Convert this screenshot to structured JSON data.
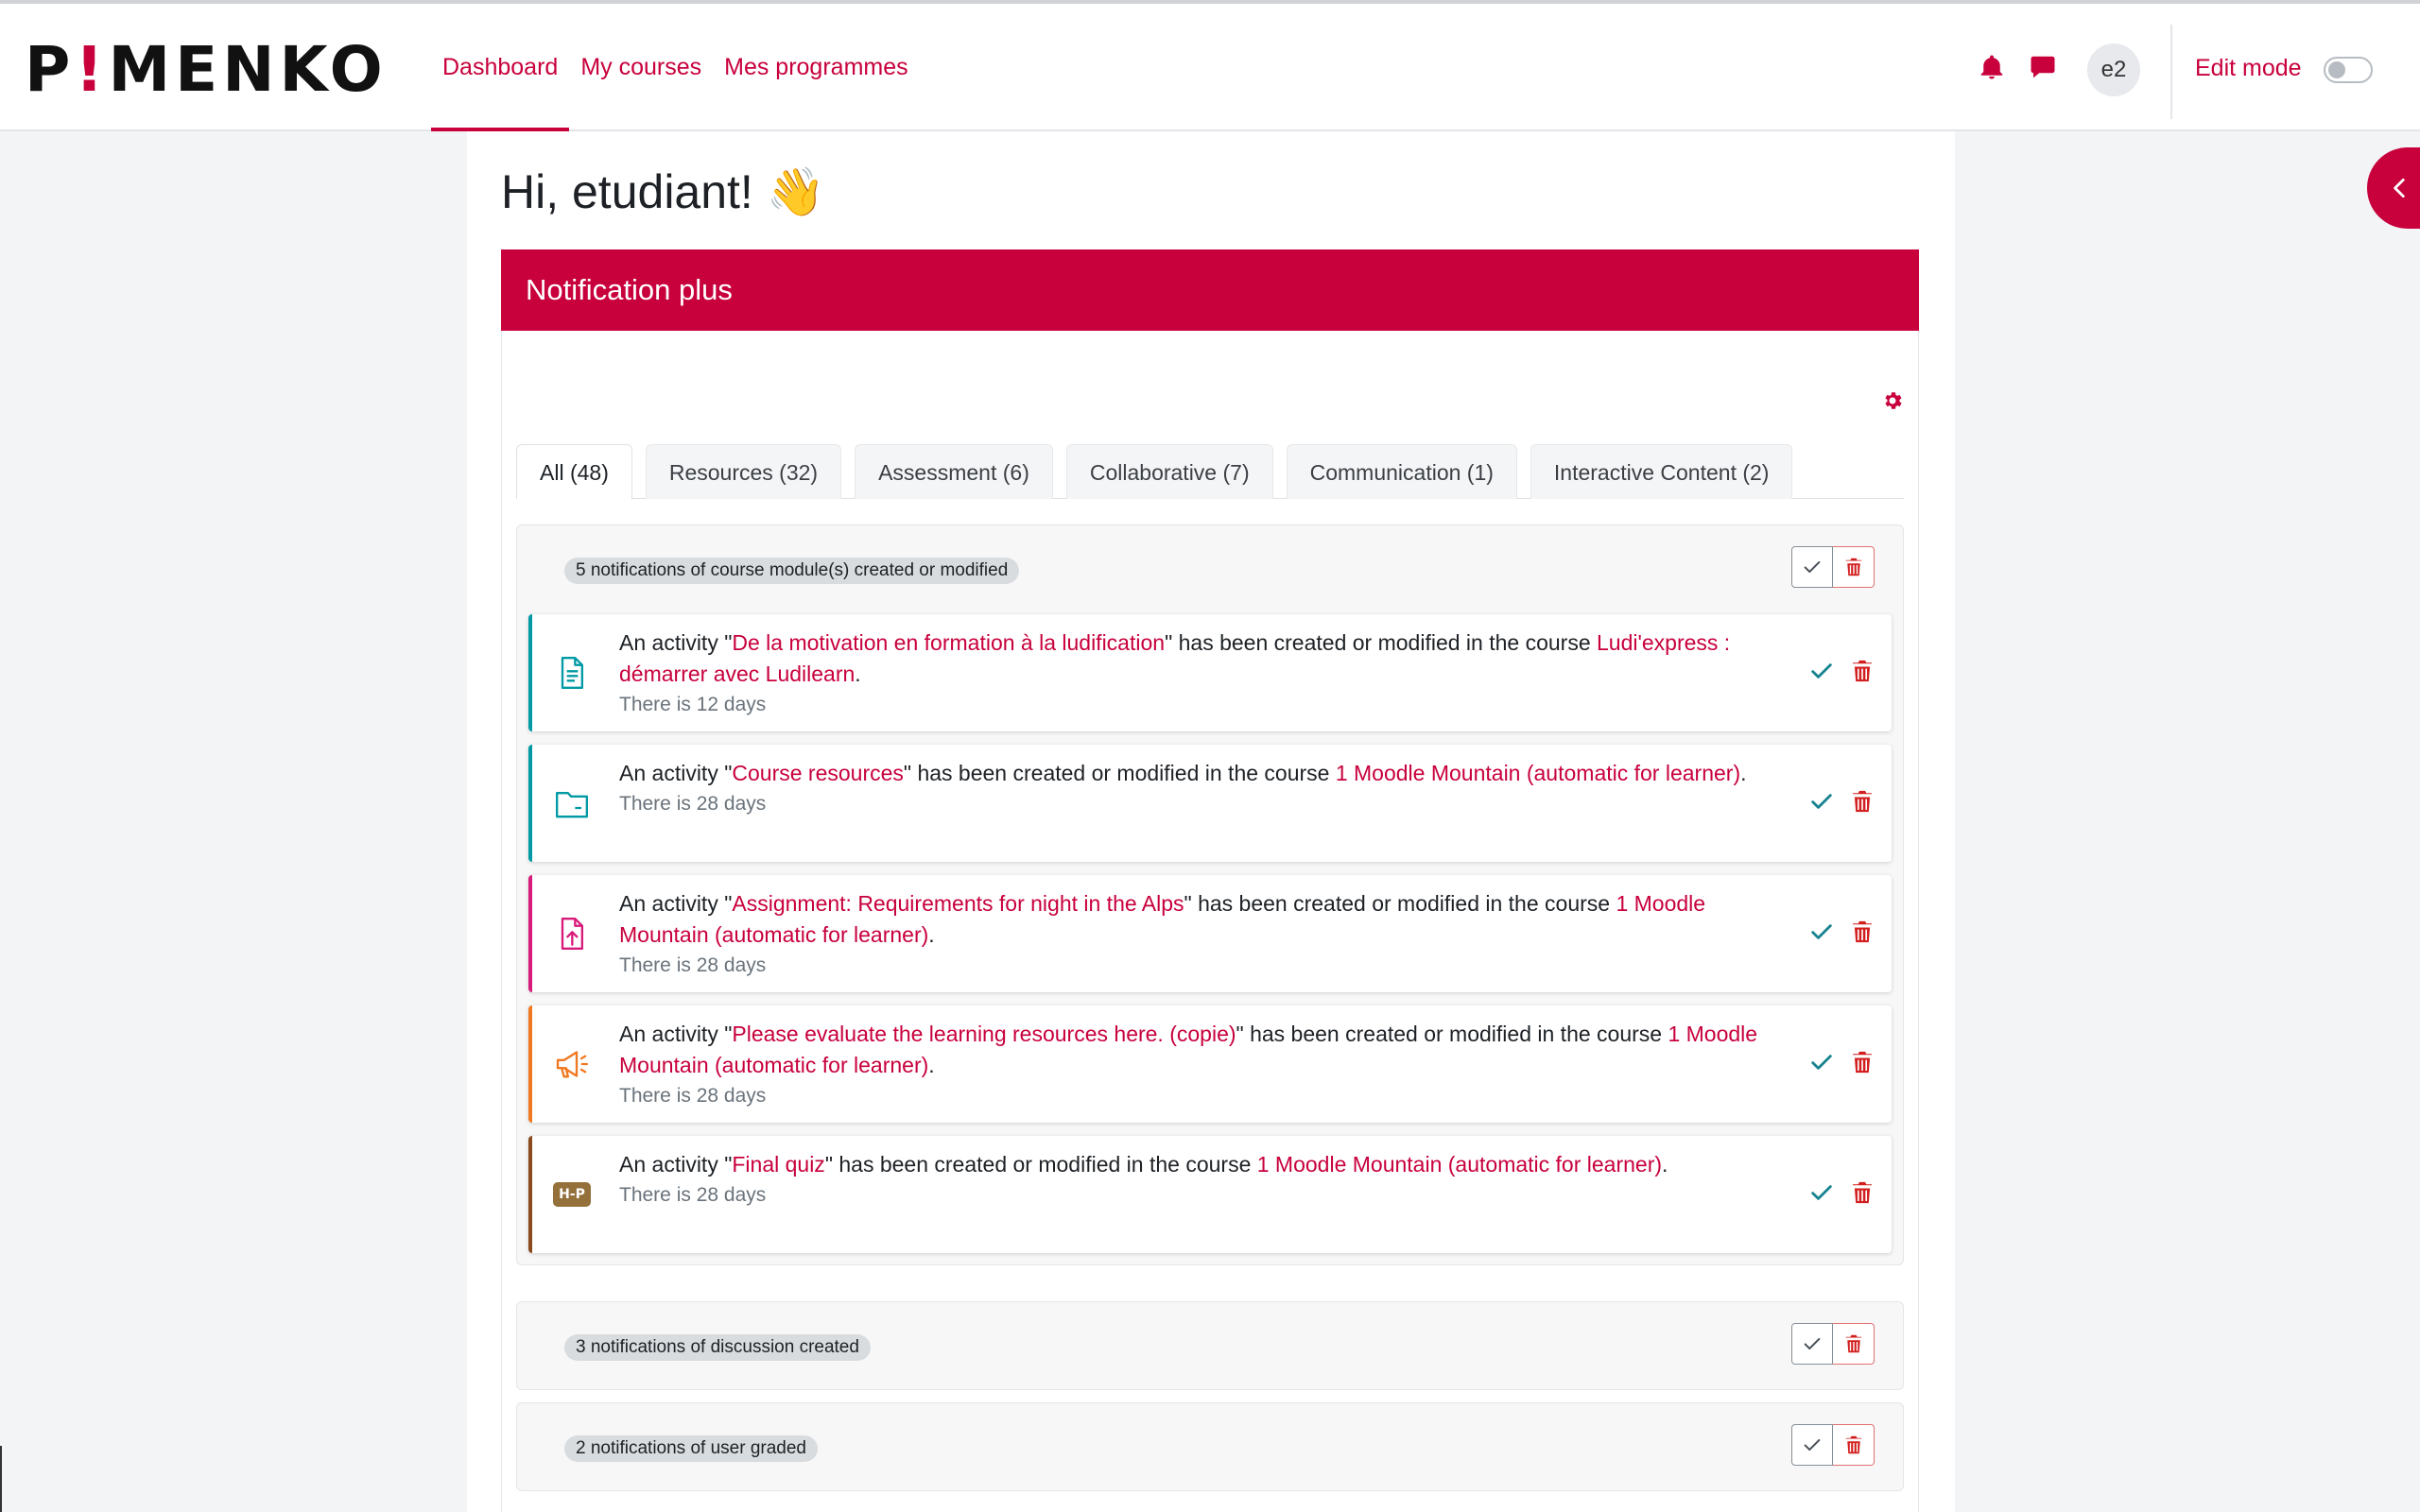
{
  "brand": {
    "logo_prefix": "P",
    "logo_bang": "!",
    "logo_suffix": "MENKO"
  },
  "nav": {
    "items": [
      {
        "label": "Dashboard",
        "active": true
      },
      {
        "label": "My courses",
        "active": false
      },
      {
        "label": "Mes programmes",
        "active": false
      }
    ]
  },
  "user": {
    "avatar_initials": "e2",
    "edit_mode_label": "Edit mode",
    "edit_mode_on": false
  },
  "page": {
    "greeting": "Hi, etudiant! 👋"
  },
  "block": {
    "title": "Notification plus"
  },
  "tabs": [
    {
      "label": "All (48)",
      "active": true
    },
    {
      "label": "Resources (32)",
      "active": false
    },
    {
      "label": "Assessment (6)",
      "active": false
    },
    {
      "label": "Collaborative (7)",
      "active": false
    },
    {
      "label": "Communication (1)",
      "active": false
    },
    {
      "label": "Interactive Content (2)",
      "active": false
    }
  ],
  "groups": [
    {
      "title": "5 notifications of course module(s) created or modified",
      "items": [
        {
          "icon": "page-icon",
          "accent": "#009aa5",
          "prefix": "An activity \"",
          "activity": "De la motivation en formation à la ludification",
          "middle": "\" has been created or modified in the course ",
          "course": "Ludi'express : démarrer avec Ludilearn",
          "suffix": ".",
          "when": "There is 12 days"
        },
        {
          "icon": "folder-icon",
          "accent": "#009aa5",
          "prefix": "An activity \"",
          "activity": "Course resources",
          "middle": "\" has been created or modified in the course ",
          "course": "1 Moodle Mountain (automatic for learner)",
          "suffix": ".",
          "when": "There is 28 days"
        },
        {
          "icon": "assignment-upload-icon",
          "accent": "#d81b7a",
          "prefix": "An activity \"",
          "activity": "Assignment: Requirements for night in the Alps",
          "middle": "\" has been created or modified in the course ",
          "course": "1 Moodle Mountain (automatic for learner)",
          "suffix": ".",
          "when": "There is 28 days"
        },
        {
          "icon": "megaphone-icon",
          "accent": "#f07820",
          "prefix": "An activity \"",
          "activity": "Please evaluate the learning resources here. (copie)",
          "middle": "\" has been created or modified in the course ",
          "course": "1 Moodle Mountain (automatic for learner)",
          "suffix": ".",
          "when": "There is 28 days"
        },
        {
          "icon": "h5p-icon",
          "accent": "#8b4a1c",
          "icon_text": "H-P",
          "prefix": "An activity \"",
          "activity": "Final quiz",
          "middle": "\" has been created or modified in the course ",
          "course": "1 Moodle Mountain (automatic for learner)",
          "suffix": ".",
          "when": "There is 28 days"
        }
      ]
    },
    {
      "title": "3 notifications of discussion created",
      "items": []
    },
    {
      "title": "2 notifications of user graded",
      "items": []
    }
  ],
  "colors": {
    "brand": "#c8003c",
    "check": "#17838f",
    "delete": "#d21e1e"
  }
}
